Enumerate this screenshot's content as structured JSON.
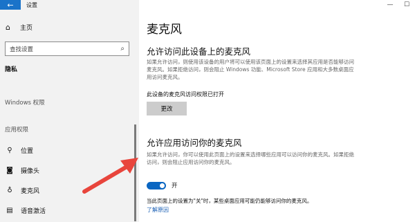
{
  "window": {
    "back_glyph": "←",
    "title": "设置",
    "minimize_glyph": "—",
    "maximize_glyph": "☐"
  },
  "sidebar": {
    "home": {
      "icon": "home-icon",
      "label": "主页"
    },
    "search": {
      "placeholder": "查找设置",
      "icon": "search-icon"
    },
    "section_privacy": "隐私",
    "section_windows": "Windows 权限",
    "section_apps": "应用权限",
    "items": [
      {
        "icon": "location-icon",
        "label": "位置"
      },
      {
        "icon": "camera-icon",
        "label": "摄像头"
      },
      {
        "icon": "microphone-icon",
        "label": "麦克风"
      },
      {
        "icon": "voice-activation-icon",
        "label": "语音激活"
      }
    ]
  },
  "main": {
    "title": "麦克风",
    "device_section": {
      "heading": "允许访问此设备上的麦克风",
      "description": "如果允许访问，则使用该设备的用户将可以使用该页面上的设置来选择其应用是否能够访问麦克风。如果拒绝访问，则会阻止 Windows 功能、Microsoft Store 应用和大多数桌面应用访问麦克风。",
      "status": "此设备的麦克风访问权限已打开",
      "change_button": "更改"
    },
    "app_section": {
      "heading": "允许应用访问你的麦克风",
      "description": "如果允许访问，你可以使用此页面上的设置来选择哪些应用可以访问你的麦克风。如果拒绝访问，则会阻止应用访问你的麦克风。",
      "toggle_on": true,
      "toggle_label": "开",
      "note": "当此页面上的设置为\"关\"时，某些桌面应用可能仍能够访问你的麦克风。",
      "learn_more": "了解原因"
    }
  },
  "colors": {
    "accent": "#0a66c2",
    "back_button": "#1a73c9",
    "annotation_arrow": "#e8453c"
  }
}
